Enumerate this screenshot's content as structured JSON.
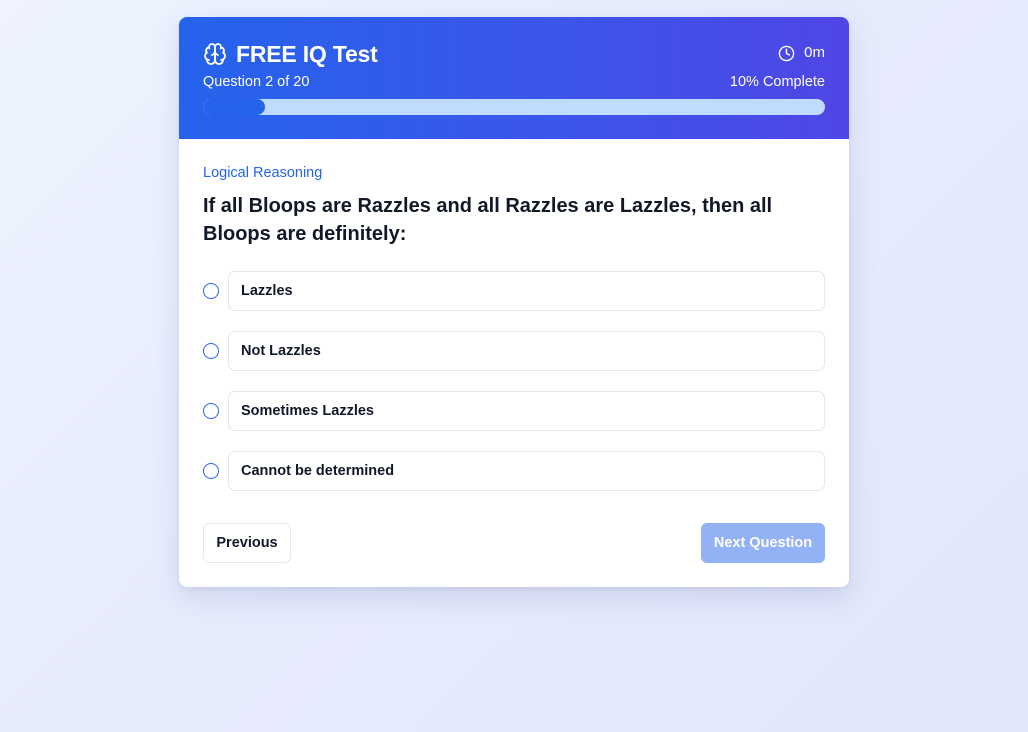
{
  "header": {
    "title": "FREE IQ Test",
    "timer": "0m",
    "question_count": "Question 2 of 20",
    "complete_label": "10% Complete",
    "progress_fraction": 0.1,
    "brand_icon": "brain-icon",
    "timer_icon": "clock-icon"
  },
  "question": {
    "category": "Logical Reasoning",
    "text": "If all Bloops are Razzles and all Razzles are Lazzles, then all Bloops are definitely:",
    "options": [
      {
        "label": "Lazzles"
      },
      {
        "label": "Not Lazzles"
      },
      {
        "label": "Sometimes Lazzles"
      },
      {
        "label": "Cannot be determined"
      }
    ]
  },
  "navigation": {
    "previous_label": "Previous",
    "next_label": "Next Question"
  },
  "colors": {
    "accent": "#2563eb",
    "header_gradient_end": "#4f46e5",
    "progress_track": "#bfdbfe",
    "next_disabled": "#93b1f5"
  }
}
